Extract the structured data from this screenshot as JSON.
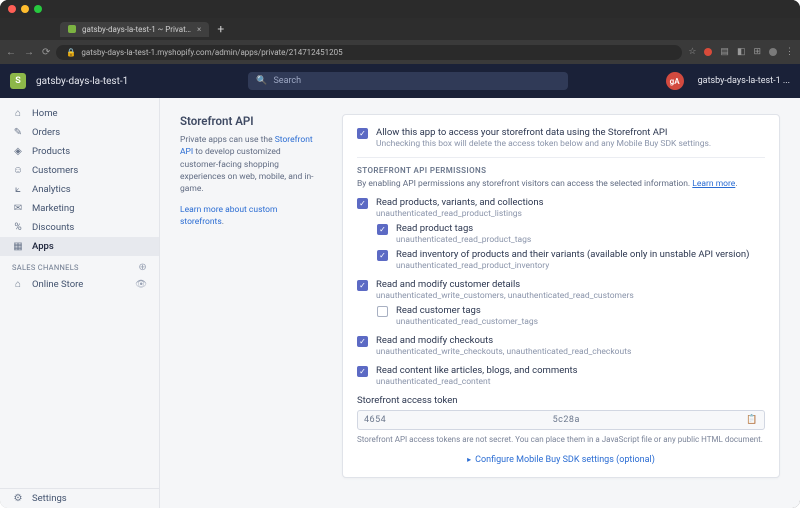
{
  "browser": {
    "tab_title": "gatsby-days-la-test-1 ~ Privat…",
    "url": "gatsby-days-la-test-1.myshopify.com/admin/apps/private/214712451205"
  },
  "topbar": {
    "store_name": "gatsby-days-la-test-1",
    "search_placeholder": "Search",
    "avatar_initials": "gA",
    "user_label": "gatsby-days-la-test-1 ..."
  },
  "sidebar": {
    "items": [
      {
        "icon": "⌂",
        "label": "Home"
      },
      {
        "icon": "✎",
        "label": "Orders"
      },
      {
        "icon": "◈",
        "label": "Products"
      },
      {
        "icon": "☺",
        "label": "Customers"
      },
      {
        "icon": "⟀",
        "label": "Analytics"
      },
      {
        "icon": "✉",
        "label": "Marketing"
      },
      {
        "icon": "%",
        "label": "Discounts"
      },
      {
        "icon": "▦",
        "label": "Apps"
      }
    ],
    "sales_channels_label": "SALES CHANNELS",
    "online_store_label": "Online Store",
    "settings_label": "Settings"
  },
  "page": {
    "section_title": "Storefront API",
    "desc_prefix": "Private apps can use the ",
    "desc_link": "Storefront API",
    "desc_suffix": " to develop customized customer-facing shopping experiences on web, mobile, and in-game.",
    "learn_more": "Learn more about custom storefronts"
  },
  "card": {
    "allow_title": "Allow this app to access your storefront data using the Storefront API",
    "allow_sub": "Unchecking this box will delete the access token below and any Mobile Buy SDK settings.",
    "perm_heading": "STOREFRONT API PERMISSIONS",
    "perm_intro_prefix": "By enabling API permissions any storefront visitors can access the selected information. ",
    "perm_intro_link": "Learn more",
    "perms": [
      {
        "title": "Read products, variants, and collections",
        "scope": "unauthenticated_read_product_listings",
        "checked": true,
        "children": [
          {
            "title": "Read product tags",
            "scope": "unauthenticated_read_product_tags",
            "checked": true
          },
          {
            "title": "Read inventory of products and their variants (available only in unstable API version)",
            "scope": "unauthenticated_read_product_inventory",
            "checked": true
          }
        ]
      },
      {
        "title": "Read and modify customer details",
        "scope": "unauthenticated_write_customers, unauthenticated_read_customers",
        "checked": true,
        "children": [
          {
            "title": "Read customer tags",
            "scope": "unauthenticated_read_customer_tags",
            "checked": false
          }
        ]
      },
      {
        "title": "Read and modify checkouts",
        "scope": "unauthenticated_write_checkouts, unauthenticated_read_checkouts",
        "checked": true
      },
      {
        "title": "Read content like articles, blogs, and comments",
        "scope": "unauthenticated_read_content",
        "checked": true
      }
    ],
    "token_label": "Storefront access token",
    "token_left": "4654",
    "token_right": "5c28a",
    "token_note": "Storefront API access tokens are not secret. You can place them in a JavaScript file or any public HTML document.",
    "configure_link": "Configure Mobile Buy SDK settings (optional)"
  }
}
